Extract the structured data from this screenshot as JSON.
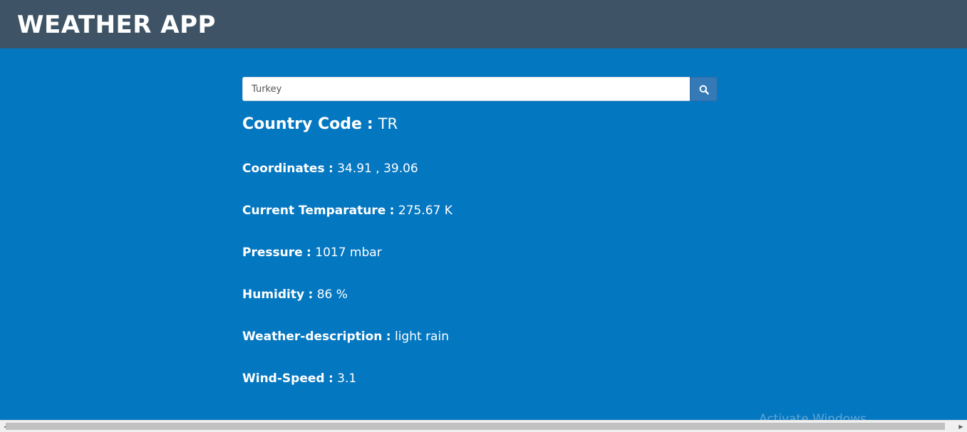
{
  "header": {
    "title": "WEATHER APP"
  },
  "search": {
    "value": "Turkey",
    "icon": "search-icon"
  },
  "result": {
    "country_code": {
      "label": "Country Code",
      "sep": ":",
      "value": "TR"
    },
    "coordinates": {
      "label": "Coordinates",
      "sep": ":",
      "value": "34.91 , 39.06"
    },
    "temperature": {
      "label": "Current Temparature",
      "sep": ":",
      "value": "275.67 K"
    },
    "pressure": {
      "label": "Pressure",
      "sep": ":",
      "value": "1017 mbar"
    },
    "humidity": {
      "label": "Humidity",
      "sep": ":",
      "value": "86 %"
    },
    "description": {
      "label": "Weather-description",
      "sep": ":",
      "value": "light rain"
    },
    "wind_speed": {
      "label": "Wind-Speed",
      "sep": ":",
      "value": "3.1"
    }
  },
  "watermark": "Activate Windows",
  "colors": {
    "background": "#0477c1",
    "navbar": "#3e5466",
    "search_button": "#337ab7"
  }
}
